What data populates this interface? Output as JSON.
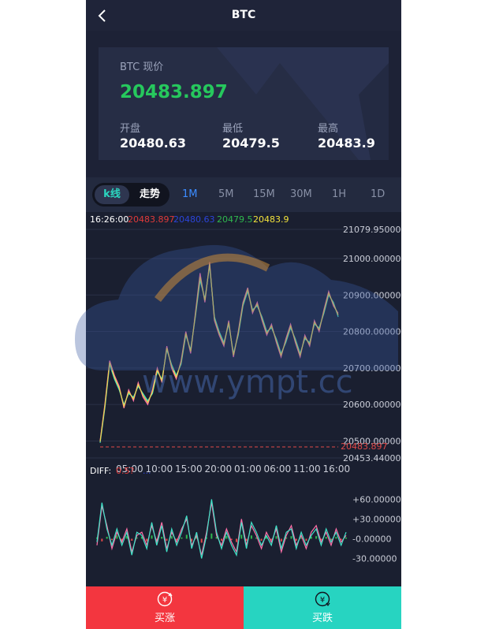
{
  "header": {
    "title": "BTC"
  },
  "price": {
    "label": "BTC 现价",
    "current": "20483.897",
    "open_label": "开盘",
    "open": "20480.63",
    "low_label": "最低",
    "low": "20479.5",
    "high_label": "最高",
    "high": "20483.9"
  },
  "chart_tabs": {
    "mode_kline": "k线",
    "mode_trend": "走势",
    "periods": [
      "1M",
      "5M",
      "15M",
      "30M",
      "1H",
      "1D"
    ],
    "active_period": "1M"
  },
  "chart_data": [
    {
      "type": "line",
      "info_row": {
        "time": "16:26:00",
        "open": "20483.897",
        "close": "20480.63",
        "low": "20479.5",
        "high": "20483.9"
      },
      "y_ticks": [
        "21079.95000",
        "21000.00000",
        "20900.00000",
        "20800.00000",
        "20700.00000",
        "20600.00000",
        "20500.00000",
        "20453.44000"
      ],
      "ylim": [
        20453.44,
        21079.95
      ],
      "current_price_line": "20483.897",
      "x_ticks": [
        "05:00",
        "10:00",
        "15:00",
        "20:00",
        "01:00",
        "06:00",
        "11:00",
        "16:00"
      ],
      "x": [
        0,
        1,
        2,
        3,
        4,
        5,
        6,
        7,
        8,
        9,
        10,
        11,
        12,
        13,
        14,
        15,
        16,
        17,
        18,
        19,
        20,
        21,
        22,
        23,
        24,
        25,
        26,
        27,
        28,
        29,
        30,
        31,
        32,
        33,
        34,
        35,
        36,
        37,
        38,
        39,
        40,
        41,
        42,
        43,
        44,
        45,
        46,
        47,
        48,
        49,
        50
      ],
      "series": [
        {
          "values": [
            20500,
            20600,
            20720,
            20680,
            20650,
            20590,
            20640,
            20610,
            20660,
            20620,
            20600,
            20640,
            20700,
            20660,
            20760,
            20700,
            20670,
            20720,
            20800,
            20740,
            20850,
            20960,
            20880,
            20990,
            20830,
            20790,
            20760,
            20830,
            20730,
            20800,
            20880,
            20920,
            20850,
            20880,
            20830,
            20790,
            20820,
            20770,
            20730,
            20780,
            20820,
            20770,
            20730,
            20790,
            20760,
            20830,
            20800,
            20860,
            20910,
            20870,
            20850
          ],
          "color": "#ff6fa8"
        },
        {
          "values": [
            20495,
            20590,
            20710,
            20670,
            20640,
            20600,
            20630,
            20620,
            20650,
            20630,
            20610,
            20630,
            20690,
            20670,
            20750,
            20710,
            20680,
            20710,
            20790,
            20750,
            20840,
            20940,
            20890,
            20980,
            20840,
            20800,
            20770,
            20820,
            20740,
            20790,
            20870,
            20910,
            20860,
            20870,
            20840,
            20800,
            20810,
            20780,
            20740,
            20770,
            20810,
            20780,
            20740,
            20780,
            20770,
            20820,
            20810,
            20850,
            20900,
            20880,
            20840
          ],
          "color": "#3fe3c8"
        },
        {
          "values": [
            20498,
            20595,
            20715,
            20675,
            20645,
            20595,
            20635,
            20615,
            20655,
            20625,
            20605,
            20635,
            20695,
            20665,
            20755,
            20705,
            20675,
            20715,
            20795,
            20745,
            20845,
            20950,
            20885,
            20985,
            20835,
            20795,
            20765,
            20825,
            20735,
            20795,
            20875,
            20915,
            20855,
            20875,
            20835,
            20795,
            20815,
            20775,
            20735,
            20775,
            20815,
            20775,
            20735,
            20785,
            20765,
            20825,
            20805,
            20855,
            20905,
            20875,
            20845
          ],
          "color": "#f2d24b"
        }
      ]
    },
    {
      "type": "line",
      "info_row": {
        "label": "DIFF:",
        "v1": "0.5?",
        "v2": "..."
      },
      "y_ticks": [
        "+60.00000",
        "+30.00000",
        "-0.00000",
        "-30.00000"
      ],
      "ylim": [
        -45,
        75
      ],
      "x": [
        0,
        1,
        2,
        3,
        4,
        5,
        6,
        7,
        8,
        9,
        10,
        11,
        12,
        13,
        14,
        15,
        16,
        17,
        18,
        19,
        20,
        21,
        22,
        23,
        24,
        25,
        26,
        27,
        28,
        29,
        30,
        31,
        32,
        33,
        34,
        35,
        36,
        37,
        38,
        39,
        40,
        41,
        42,
        43,
        44,
        45,
        46,
        47,
        48,
        49,
        50
      ],
      "series": [
        {
          "values": [
            -10,
            50,
            20,
            -15,
            10,
            -5,
            15,
            -20,
            5,
            10,
            -10,
            20,
            -5,
            25,
            -15,
            10,
            -5,
            15,
            30,
            -10,
            5,
            -25,
            10,
            55,
            5,
            -10,
            15,
            -5,
            -20,
            30,
            -10,
            20,
            5,
            -15,
            10,
            -5,
            15,
            -20,
            5,
            20,
            -10,
            5,
            -15,
            10,
            20,
            -5,
            10,
            -10,
            15,
            -5,
            5
          ],
          "color": "#ff6fa8"
        },
        {
          "values": [
            -5,
            55,
            15,
            -10,
            15,
            -10,
            10,
            -25,
            10,
            5,
            -15,
            25,
            -10,
            20,
            -20,
            15,
            -10,
            10,
            35,
            -15,
            10,
            -30,
            5,
            60,
            10,
            -15,
            10,
            -10,
            -25,
            25,
            -15,
            25,
            10,
            -10,
            5,
            -10,
            20,
            -15,
            10,
            15,
            -15,
            10,
            -10,
            5,
            15,
            -10,
            15,
            -5,
            10,
            -10,
            10
          ],
          "color": "#3fe3c8"
        }
      ],
      "bars": [
        2,
        -4,
        3,
        -2,
        5,
        -6,
        4,
        -3,
        2,
        3,
        -4,
        5,
        -2,
        3,
        -3,
        4,
        -2,
        2,
        6,
        -4,
        3,
        -6,
        2,
        8,
        3,
        -3,
        4,
        -2,
        -5,
        6,
        -3,
        5,
        2,
        -3,
        3,
        -2,
        4,
        -4,
        2,
        4,
        -3,
        2,
        -3,
        3,
        4,
        -2,
        3,
        -2,
        3,
        -2,
        2
      ]
    }
  ],
  "actions": {
    "buy_up": "买涨",
    "buy_down": "买跌"
  },
  "watermark": {
    "text": "www.ympt.cc"
  },
  "colors": {
    "green": "#26c85d",
    "red": "#f3363f",
    "teal": "#27d4c1",
    "blue": "#3c8cff"
  }
}
